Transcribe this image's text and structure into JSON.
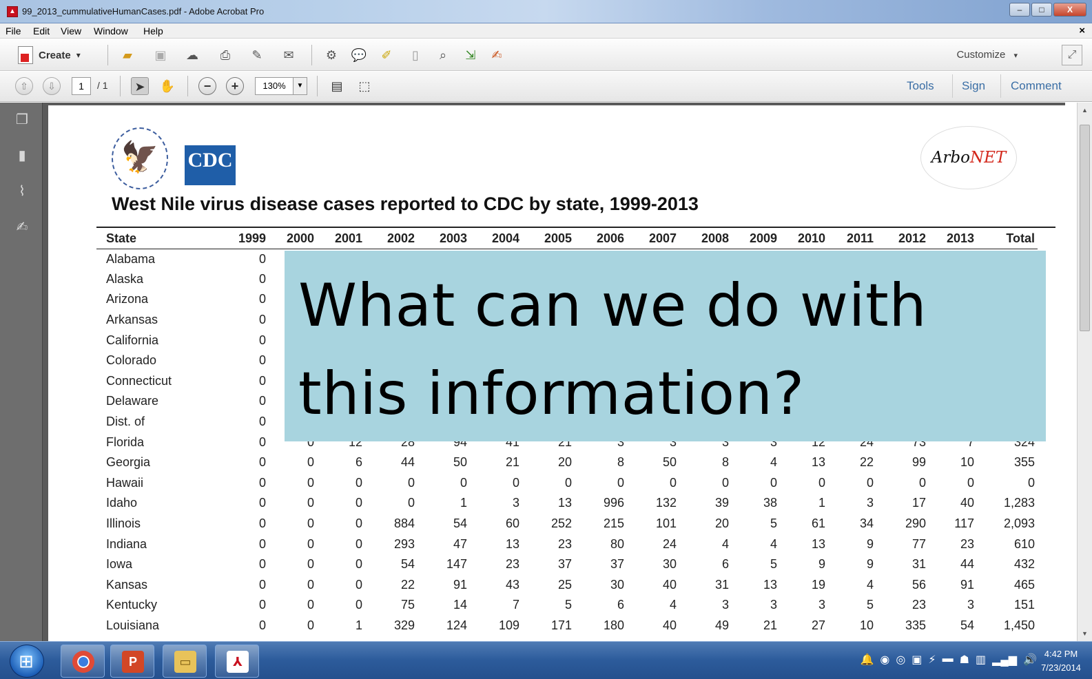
{
  "window": {
    "title": "99_2013_cummulativeHumanCases.pdf - Adobe Acrobat Pro",
    "buttons": {
      "minimize": "–",
      "maximize": "□",
      "close": "X"
    }
  },
  "menu": [
    "File",
    "Edit",
    "View",
    "Window",
    "Help"
  ],
  "menu_close": "×",
  "toolbar": {
    "create_label": "Create",
    "create_arrow": "▾",
    "customize_label": "Customize",
    "customize_arrow": "▾"
  },
  "nav": {
    "page_number": "1",
    "page_count": "/ 1",
    "zoom": "130%",
    "tools": "Tools",
    "sign": "Sign",
    "comment": "Comment"
  },
  "document": {
    "cdc_logo": "CDC",
    "arbonet_a": "Arbo",
    "arbonet_b": "NET",
    "title": "West Nile virus disease cases reported to CDC by state, 1999-2013",
    "headers": [
      "State",
      "1999",
      "2000",
      "2001",
      "2002",
      "2003",
      "2004",
      "2005",
      "2006",
      "2007",
      "2008",
      "2009",
      "2010",
      "2011",
      "2012",
      "2013",
      "Total"
    ],
    "rows": [
      [
        "Alabama",
        "0",
        "",
        "",
        "",
        "",
        "",
        "",
        "",
        "",
        "",
        "",
        "",
        "",
        "",
        "",
        ""
      ],
      [
        "Alaska",
        "0",
        "",
        "",
        "",
        "",
        "",
        "",
        "",
        "",
        "",
        "",
        "",
        "",
        "",
        "",
        ""
      ],
      [
        "Arizona",
        "0",
        "",
        "",
        "",
        "",
        "",
        "",
        "",
        "",
        "",
        "",
        "",
        "",
        "",
        "",
        ""
      ],
      [
        "Arkansas",
        "0",
        "",
        "",
        "",
        "",
        "",
        "",
        "",
        "",
        "",
        "",
        "",
        "",
        "",
        "",
        ""
      ],
      [
        "California",
        "0",
        "",
        "",
        "",
        "",
        "",
        "",
        "",
        "",
        "",
        "",
        "",
        "",
        "",
        "",
        ""
      ],
      [
        "Colorado",
        "0",
        "",
        "",
        "",
        "",
        "",
        "",
        "",
        "",
        "",
        "",
        "",
        "",
        "",
        "",
        ""
      ],
      [
        "Connecticut",
        "0",
        "",
        "",
        "",
        "",
        "",
        "",
        "",
        "",
        "",
        "",
        "",
        "",
        "",
        "",
        ""
      ],
      [
        "Delaware",
        "0",
        "",
        "",
        "",
        "",
        "",
        "",
        "",
        "",
        "",
        "",
        "",
        "",
        "",
        "",
        ""
      ],
      [
        "Dist. of",
        "0",
        "",
        "",
        "",
        "",
        "",
        "",
        "",
        "",
        "",
        "",
        "",
        "",
        "",
        "",
        ""
      ],
      [
        "Florida",
        "0",
        "0",
        "12",
        "28",
        "94",
        "41",
        "21",
        "3",
        "3",
        "3",
        "3",
        "12",
        "24",
        "73",
        "7",
        "324"
      ],
      [
        "Georgia",
        "0",
        "0",
        "6",
        "44",
        "50",
        "21",
        "20",
        "8",
        "50",
        "8",
        "4",
        "13",
        "22",
        "99",
        "10",
        "355"
      ],
      [
        "Hawaii",
        "0",
        "0",
        "0",
        "0",
        "0",
        "0",
        "0",
        "0",
        "0",
        "0",
        "0",
        "0",
        "0",
        "0",
        "0",
        "0"
      ],
      [
        "Idaho",
        "0",
        "0",
        "0",
        "0",
        "1",
        "3",
        "13",
        "996",
        "132",
        "39",
        "38",
        "1",
        "3",
        "17",
        "40",
        "1,283"
      ],
      [
        "Illinois",
        "0",
        "0",
        "0",
        "884",
        "54",
        "60",
        "252",
        "215",
        "101",
        "20",
        "5",
        "61",
        "34",
        "290",
        "117",
        "2,093"
      ],
      [
        "Indiana",
        "0",
        "0",
        "0",
        "293",
        "47",
        "13",
        "23",
        "80",
        "24",
        "4",
        "4",
        "13",
        "9",
        "77",
        "23",
        "610"
      ],
      [
        "Iowa",
        "0",
        "0",
        "0",
        "54",
        "147",
        "23",
        "37",
        "37",
        "30",
        "6",
        "5",
        "9",
        "9",
        "31",
        "44",
        "432"
      ],
      [
        "Kansas",
        "0",
        "0",
        "0",
        "22",
        "91",
        "43",
        "25",
        "30",
        "40",
        "31",
        "13",
        "19",
        "4",
        "56",
        "91",
        "465"
      ],
      [
        "Kentucky",
        "0",
        "0",
        "0",
        "75",
        "14",
        "7",
        "5",
        "6",
        "4",
        "3",
        "3",
        "3",
        "5",
        "23",
        "3",
        "151"
      ],
      [
        "Louisiana",
        "0",
        "0",
        "1",
        "329",
        "124",
        "109",
        "171",
        "180",
        "40",
        "49",
        "21",
        "27",
        "10",
        "335",
        "54",
        "1,450"
      ]
    ]
  },
  "overlay": {
    "line1": "What can we do with",
    "line2": "this information?"
  },
  "taskbar": {
    "time": "4:42 PM",
    "date": "7/23/2014"
  },
  "colors": {
    "overlay_bg": "#a8d4df",
    "link": "#3a6ea5",
    "cdc_blue": "#1f5ea8",
    "arbonet_red": "#d3261a"
  },
  "icons": [
    "pdf-icon",
    "open-folder-icon",
    "save-icon",
    "upload-icon",
    "print-icon",
    "edit-icon",
    "email-icon",
    "gear-icon",
    "comment-icon",
    "highlight-icon",
    "page-icon",
    "search-page-icon",
    "export-icon",
    "sign-icon",
    "up-arrow-icon",
    "down-arrow-icon",
    "select-arrow-icon",
    "hand-icon",
    "zoom-out-icon",
    "zoom-in-icon",
    "fit-page-icon",
    "fit-width-icon",
    "pages-icon",
    "bookmark-icon",
    "attachment-icon",
    "signature-icon"
  ]
}
